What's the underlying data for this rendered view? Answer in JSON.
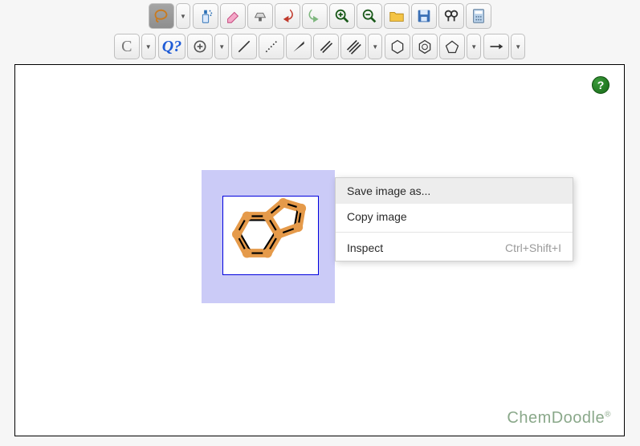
{
  "toolbar_row1": {
    "lasso": "lasso-icon",
    "spray": "spray-icon",
    "eraser": "eraser-icon",
    "iron": "clean-icon",
    "undo": "undo-icon",
    "redo": "redo-icon",
    "zoom_in": "zoom-in-icon",
    "zoom_out": "zoom-out-icon",
    "open": "open-icon",
    "save": "save-icon",
    "search": "search-icon",
    "calc": "calculator-icon"
  },
  "toolbar_row2": {
    "c_label": "C",
    "q_label": "Q?",
    "increase_charge": "charge-plus-icon",
    "single_bond": "single-bond-icon",
    "dotted_bond": "dotted-bond-icon",
    "wedge_bond": "wedge-bond-icon",
    "double_bond": "double-bond-icon",
    "triple_bond": "triple-bond-icon",
    "cyclohexane": "hexagon-icon",
    "benzene": "benzene-icon",
    "pentagon": "pentagon-icon",
    "arrow": "arrow-icon"
  },
  "context_menu": {
    "save_image_as": "Save image as...",
    "copy_image": "Copy image",
    "inspect": "Inspect",
    "inspect_shortcut": "Ctrl+Shift+I"
  },
  "help_badge": "?",
  "brand": "ChemDoodle",
  "brand_mark": "®"
}
